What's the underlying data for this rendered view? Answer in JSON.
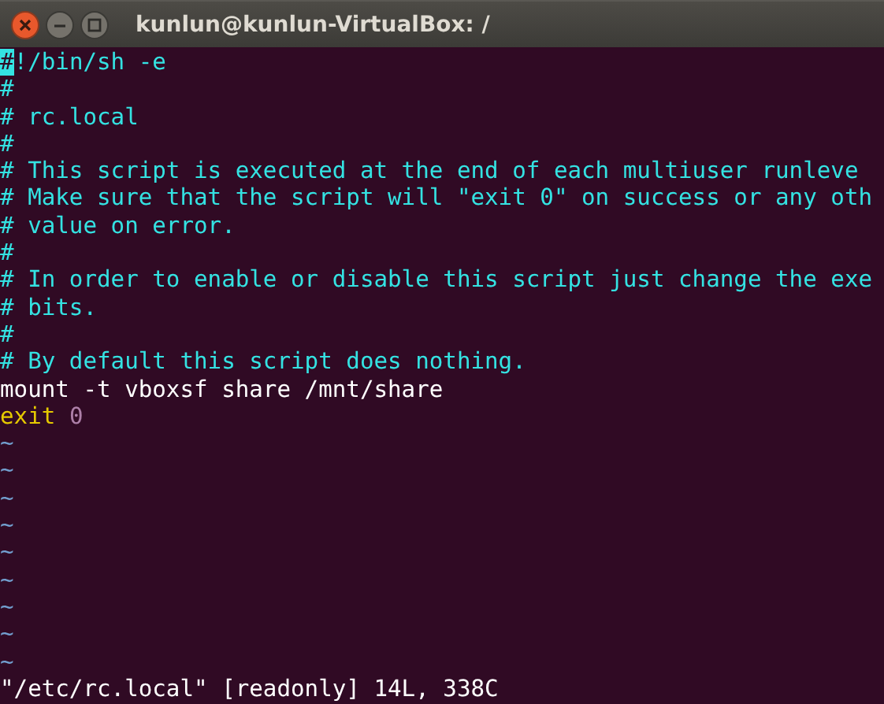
{
  "window": {
    "title": "kunlun@kunlun-VirtualBox: /"
  },
  "buffer": {
    "lines": [
      {
        "kind": "shebang",
        "cursor": "#",
        "text": "!/bin/sh -e"
      },
      {
        "kind": "comment",
        "text": "#"
      },
      {
        "kind": "comment",
        "text": "# rc.local"
      },
      {
        "kind": "comment",
        "text": "#"
      },
      {
        "kind": "comment",
        "text": "# This script is executed at the end of each multiuser runleve"
      },
      {
        "kind": "comment",
        "text": "# Make sure that the script will \"exit 0\" on success or any oth"
      },
      {
        "kind": "comment",
        "text": "# value on error."
      },
      {
        "kind": "comment",
        "text": "#"
      },
      {
        "kind": "comment",
        "text": "# In order to enable or disable this script just change the exe"
      },
      {
        "kind": "comment",
        "text": "# bits."
      },
      {
        "kind": "comment",
        "text": "#"
      },
      {
        "kind": "comment",
        "text": "# By default this script does nothing."
      },
      {
        "kind": "command",
        "text": "mount -t vboxsf share /mnt/share"
      },
      {
        "kind": "exit",
        "keyword": "exit",
        "value": "0"
      }
    ],
    "tildes": [
      "~",
      "~",
      "~",
      "~",
      "~",
      "~",
      "~",
      "~",
      "~"
    ],
    "status": "\"/etc/rc.local\" [readonly] 14L, 338C"
  }
}
